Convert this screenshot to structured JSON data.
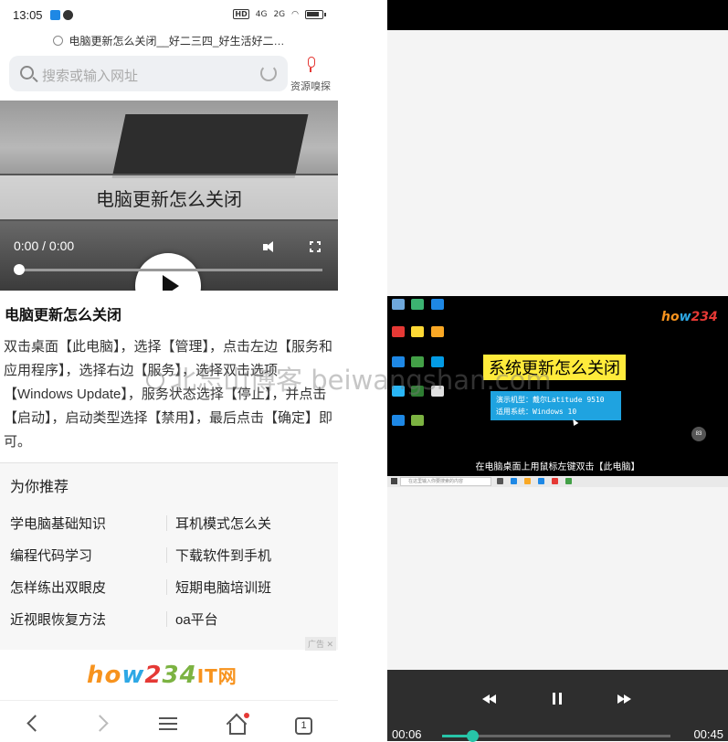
{
  "status": {
    "time": "13:05",
    "net1": "4G",
    "net2": "2G",
    "hd": "HD",
    "battery_icon": "battery-icon"
  },
  "browser": {
    "page_title": "电脑更新怎么关闭__好二三四_好生活好二…",
    "search_placeholder": "搜索或输入网址",
    "sniffer_label": "资源嗅探"
  },
  "video": {
    "overlay_text": "电脑更新怎么关闭",
    "time": "0:00 / 0:00",
    "progress": 0
  },
  "article": {
    "title": "电脑更新怎么关闭",
    "body": "双击桌面【此电脑】，选择【管理】，点击左边【服务和应用程序】，选择右边【服务】，选择双击选项【Windows Update】，服务状态选择【停止】，并点击【启动】，启动类型选择【禁用】，最后点击【确定】即可。"
  },
  "recommend": {
    "title": "为你推荐",
    "items": [
      "学电脑基础知识",
      "耳机模式怎么关",
      "编程代码学习",
      "下载软件到手机",
      "怎样练出双眼皮",
      "短期电脑培训班",
      "近视眼恢复方法",
      "oa平台"
    ],
    "ad_label": "广告"
  },
  "logo": {
    "p1": "ho",
    "p2": "w",
    "p3": "2",
    "p4": "34",
    "it": "IT网"
  },
  "bottom_nav": {
    "tab_count": "1"
  },
  "desktop": {
    "logo_p1": "ho",
    "logo_p2": "w",
    "logo_p3": "234",
    "title": "系统更新怎么关闭",
    "info_line1": "演示机型：戴尔Latitude 9510",
    "info_line2": "适用系统：Windows 10",
    "caption": "在电脑桌面上用鼠标左键双击【此电脑】",
    "badge": "83",
    "taskbar_search": "在这里输入你要搜索的内容"
  },
  "player": {
    "current": "00:06",
    "total": "00:45",
    "progress": 0.133,
    "accent": "#27c4a8"
  },
  "watermark": "北忘山博客 beiwangshan.com"
}
